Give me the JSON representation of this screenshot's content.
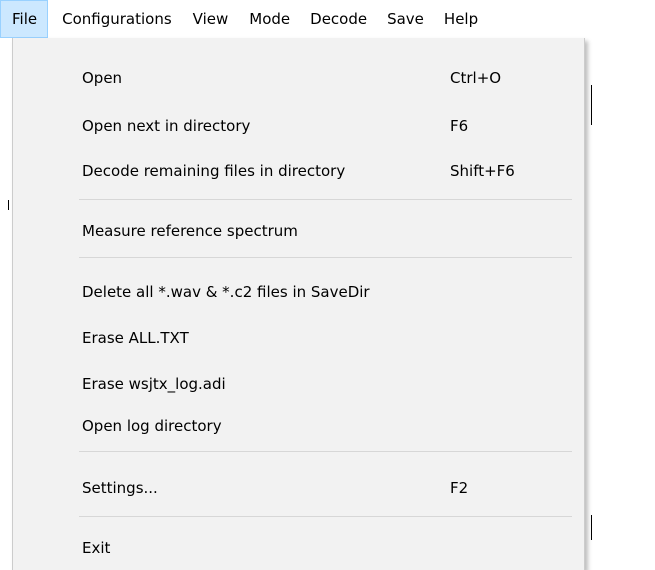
{
  "menubar": {
    "items": [
      {
        "label": "File"
      },
      {
        "label": "Configurations"
      },
      {
        "label": "View"
      },
      {
        "label": "Mode"
      },
      {
        "label": "Decode"
      },
      {
        "label": "Save"
      },
      {
        "label": "Help"
      }
    ],
    "active_label": "File"
  },
  "file_menu": {
    "items": [
      {
        "label": "Open",
        "shortcut": "Ctrl+O"
      },
      {
        "label": "Open next in directory",
        "shortcut": "F6"
      },
      {
        "label": "Decode remaining files in directory",
        "shortcut": "Shift+F6"
      },
      {
        "label": "Measure reference spectrum",
        "shortcut": ""
      },
      {
        "label": "Delete all *.wav & *.c2 files in SaveDir",
        "shortcut": ""
      },
      {
        "label": "Erase ALL.TXT",
        "shortcut": ""
      },
      {
        "label": "Erase wsjtx_log.adi",
        "shortcut": ""
      },
      {
        "label": "Open log directory",
        "shortcut": ""
      },
      {
        "label": "Settings...",
        "shortcut": "F2"
      },
      {
        "label": "Exit",
        "shortcut": ""
      }
    ]
  },
  "colors": {
    "menubar_active_bg": "#cce8ff",
    "menubar_active_border": "#99d1ff",
    "dropdown_bg": "#f2f2f2",
    "separator": "#d7d7d7"
  }
}
